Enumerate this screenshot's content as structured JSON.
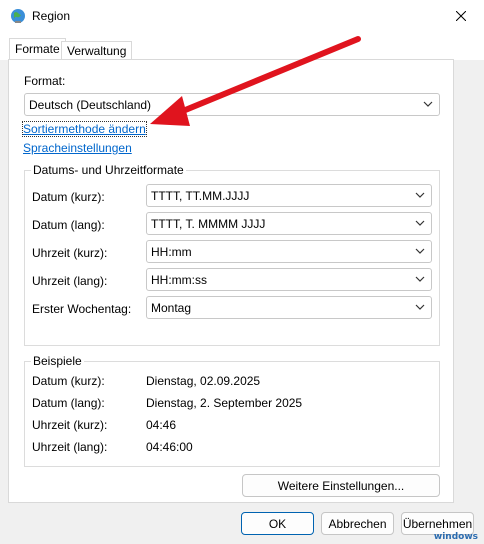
{
  "window": {
    "title": "Region"
  },
  "tabs": [
    {
      "label": "Formate",
      "active": true
    },
    {
      "label": "Verwaltung",
      "active": false
    }
  ],
  "format": {
    "label": "Format:",
    "value": "Deutsch (Deutschland)",
    "sort_link": "Sortiermethode ändern",
    "lang_link": "Spracheinstellungen"
  },
  "datetime_group": {
    "title": "Datums- und Uhrzeitformate",
    "rows": [
      {
        "label": "Datum (kurz):",
        "value": "TTTT, TT.MM.JJJJ"
      },
      {
        "label": "Datum (lang):",
        "value": "TTTT, T. MMMM JJJJ"
      },
      {
        "label": "Uhrzeit (kurz):",
        "value": "HH:mm"
      },
      {
        "label": "Uhrzeit (lang):",
        "value": "HH:mm:ss"
      },
      {
        "label": "Erster Wochentag:",
        "value": "Montag"
      }
    ]
  },
  "examples": {
    "title": "Beispiele",
    "rows": [
      {
        "label": "Datum (kurz):",
        "value": "Dienstag, 02.09.2025"
      },
      {
        "label": "Datum (lang):",
        "value": "Dienstag, 2. September 2025"
      },
      {
        "label": "Uhrzeit (kurz):",
        "value": "04:46"
      },
      {
        "label": "Uhrzeit (lang):",
        "value": "04:46:00"
      }
    ]
  },
  "buttons": {
    "more_settings": "Weitere Einstellungen...",
    "ok": "OK",
    "cancel": "Abbrechen",
    "apply": "Übernehmen"
  },
  "watermark": "windows",
  "colors": {
    "link": "#0066cc",
    "arrow": "#e0141e",
    "accent": "#0063b1"
  }
}
